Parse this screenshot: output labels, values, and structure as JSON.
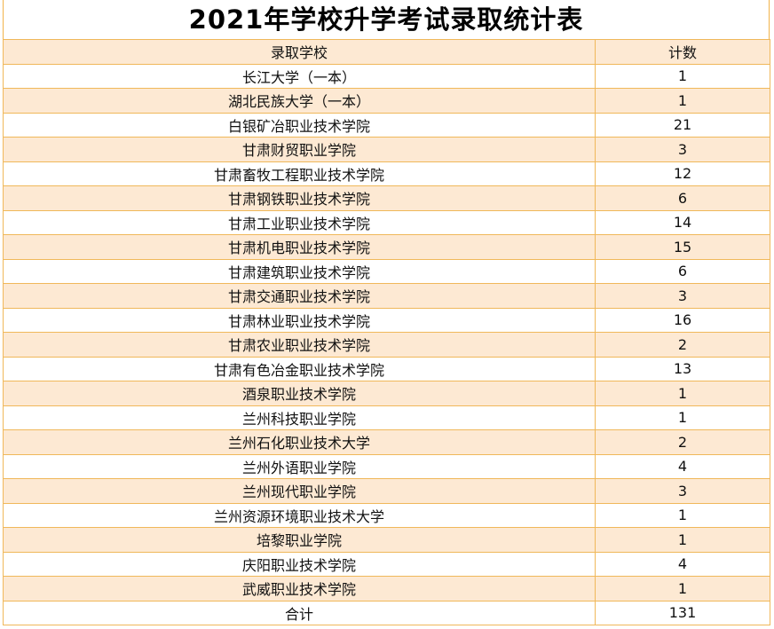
{
  "title": "2021年学校升学考试录取统计表",
  "colors": {
    "border": "#f0b85a",
    "band": "#fde9d3",
    "background": "#ffffff"
  },
  "table": {
    "headers": [
      "录取学校",
      "计数"
    ],
    "rows": [
      {
        "school": "长江大学（一本）",
        "count": "1"
      },
      {
        "school": "湖北民族大学（一本）",
        "count": "1"
      },
      {
        "school": "白银矿冶职业技术学院",
        "count": "21"
      },
      {
        "school": "甘肃财贸职业学院",
        "count": "3"
      },
      {
        "school": "甘肃畜牧工程职业技术学院",
        "count": "12"
      },
      {
        "school": "甘肃钢铁职业技术学院",
        "count": "6"
      },
      {
        "school": "甘肃工业职业技术学院",
        "count": "14"
      },
      {
        "school": "甘肃机电职业技术学院",
        "count": "15"
      },
      {
        "school": "甘肃建筑职业技术学院",
        "count": "6"
      },
      {
        "school": "甘肃交通职业技术学院",
        "count": "3"
      },
      {
        "school": "甘肃林业职业技术学院",
        "count": "16"
      },
      {
        "school": "甘肃农业职业技术学院",
        "count": "2"
      },
      {
        "school": "甘肃有色冶金职业技术学院",
        "count": "13"
      },
      {
        "school": "酒泉职业技术学院",
        "count": "1"
      },
      {
        "school": "兰州科技职业学院",
        "count": "1"
      },
      {
        "school": "兰州石化职业技术大学",
        "count": "2"
      },
      {
        "school": "兰州外语职业学院",
        "count": "4"
      },
      {
        "school": "兰州现代职业学院",
        "count": "3"
      },
      {
        "school": "兰州资源环境职业技术大学",
        "count": "1"
      },
      {
        "school": "培黎职业学院",
        "count": "1"
      },
      {
        "school": "庆阳职业技术学院",
        "count": "4"
      },
      {
        "school": "武威职业技术学院",
        "count": "1"
      }
    ],
    "total": {
      "label": "合计",
      "count": "131"
    }
  }
}
